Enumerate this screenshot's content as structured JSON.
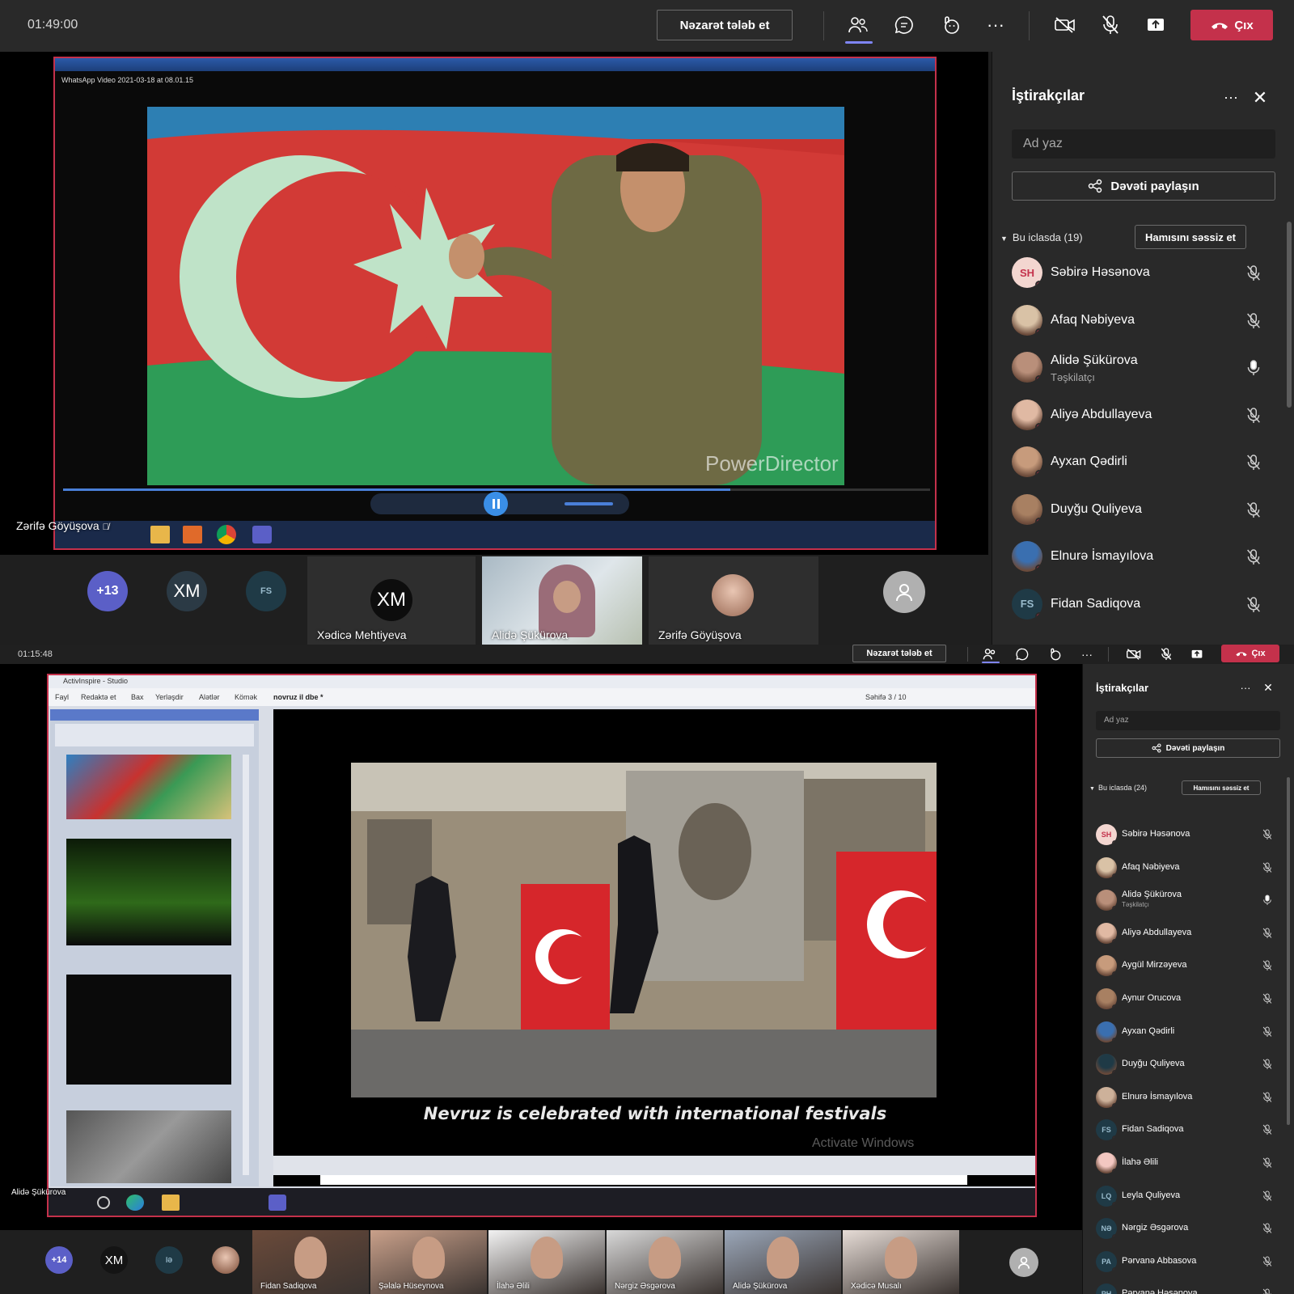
{
  "screen1": {
    "timer": "01:49:00",
    "request_control": "Nəzarət tələb et",
    "leave": "Çıx",
    "shared_window": {
      "title": "WhatsApp Video 2021-03-18 at 08.01.15",
      "watermark": "PowerDirector",
      "presenter": "Zərifə Göyüşova"
    },
    "panel": {
      "title": "İştirakçılar",
      "search_placeholder": "Ad yaz",
      "invite": "Dəvəti paylaşın",
      "section": "Bu iclasda (19)",
      "mute_all": "Hamısını səssiz et",
      "participants": [
        {
          "name": "Səbirə Həsənova",
          "initials": "SH",
          "mic": "muted"
        },
        {
          "name": "Afaq Nəbiyeva",
          "initials": "",
          "mic": "muted"
        },
        {
          "name": "Alidə Şükürova",
          "sub": "Təşkilatçı",
          "initials": "",
          "mic": "on"
        },
        {
          "name": "Aliyə Abdullayeva",
          "initials": "",
          "mic": "muted"
        },
        {
          "name": "Ayxan Qədirli",
          "initials": "",
          "mic": "muted"
        },
        {
          "name": "Duyğu Quliyeva",
          "initials": "",
          "mic": "muted"
        },
        {
          "name": "Elnurə İsmayılova",
          "initials": "",
          "mic": "muted"
        },
        {
          "name": "Fidan Sadiqova",
          "initials": "FS",
          "mic": "muted"
        }
      ]
    },
    "strip": {
      "more": "+13",
      "bubble1": "XM",
      "bubble2": "FS",
      "tiles": [
        {
          "name": "Xədicə Mehtiyeva",
          "initials": "XM"
        },
        {
          "name": "Alidə Şükürova"
        },
        {
          "name": "Zərifə Göyüşova"
        }
      ]
    }
  },
  "screen2": {
    "timer": "01:15:48",
    "request_control": "Nəzarət tələb et",
    "leave": "Çıx",
    "shared_window": {
      "app_title": "ActivInspire - Studio",
      "menu": [
        "Fayl",
        "Redaktə et",
        "Bax",
        "Yerləşdir",
        "Alətlər",
        "Kömək"
      ],
      "doc_tab": "novruz il dbe *",
      "page": "Səhifə 3 / 10",
      "caption": "Nevruz is celebrated with international festivals",
      "activate": "Activate Windows",
      "presenter": "Alidə Şükürova"
    },
    "panel": {
      "title": "İştirakçılar",
      "search_placeholder": "Ad yaz",
      "invite": "Dəvəti paylaşın",
      "section": "Bu iclasda (24)",
      "mute_all": "Hamısını səssiz et",
      "participants": [
        {
          "name": "Səbirə Həsənova",
          "initials": "SH",
          "mic": "muted"
        },
        {
          "name": "Afaq Nəbiyeva",
          "initials": "",
          "mic": "muted"
        },
        {
          "name": "Alidə Şükürova",
          "sub": "Təşkilatçı",
          "initials": "",
          "mic": "on"
        },
        {
          "name": "Aliyə Abdullayeva",
          "initials": "",
          "mic": "muted"
        },
        {
          "name": "Aygül Mirzəyeva",
          "initials": "",
          "mic": "muted"
        },
        {
          "name": "Aynur Orucova",
          "initials": "",
          "mic": "muted"
        },
        {
          "name": "Ayxan Qədirli",
          "initials": "",
          "mic": "muted"
        },
        {
          "name": "Duyğu Quliyeva",
          "initials": "",
          "mic": "muted"
        },
        {
          "name": "Elnurə İsmayılova",
          "initials": "",
          "mic": "muted"
        },
        {
          "name": "Fidan Sadiqova",
          "initials": "FS",
          "mic": "muted"
        },
        {
          "name": "İlahə Əlili",
          "initials": "",
          "mic": "muted"
        },
        {
          "name": "Leyla Quliyeva",
          "initials": "LQ",
          "mic": "muted"
        },
        {
          "name": "Nərgiz Əsgərova",
          "initials": "NƏ",
          "mic": "muted"
        },
        {
          "name": "Pərvanə Abbasova",
          "initials": "PA",
          "mic": "muted"
        },
        {
          "name": "Pərvanə Həsənova",
          "initials": "PH",
          "mic": "muted"
        }
      ]
    },
    "strip": {
      "more": "+14",
      "bubble1": "XM",
      "bubble2": "İƏ",
      "tiles": [
        {
          "name": "Fidan Sadiqova"
        },
        {
          "name": "Şəlalə Hüseynova"
        },
        {
          "name": "İlahə Əlili"
        },
        {
          "name": "Nərgiz Əsgərova"
        },
        {
          "name": "Alidə Şükürova"
        },
        {
          "name": "Xədicə Musalı"
        }
      ]
    }
  },
  "colors": {
    "accent": "#7f85f5",
    "leave": "#c4314b",
    "panel_bg": "#292929",
    "app_bg": "#1f1f1f",
    "share_border": "#c4314b"
  }
}
